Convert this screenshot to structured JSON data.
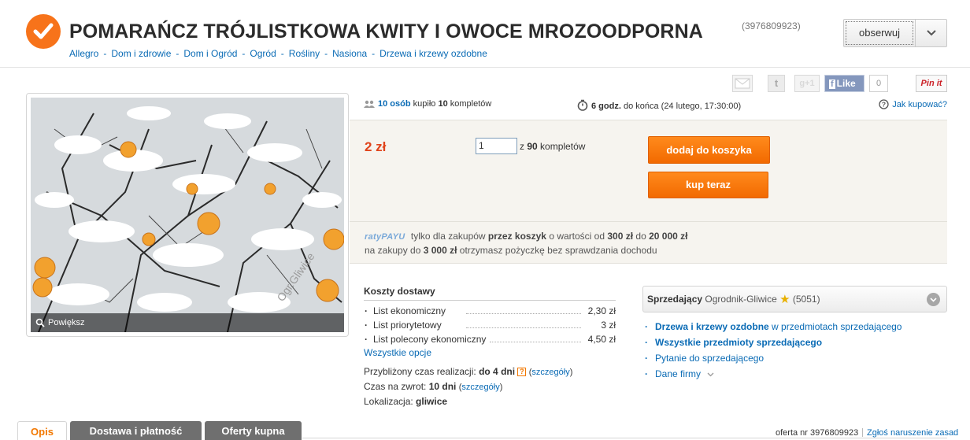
{
  "header": {
    "title": "POMARAŃCZ TRÓJLISTKOWA KWITY I OWOCE MROZOODPORNA",
    "offer_id": "(3976809923)",
    "watch_label": "obserwuj"
  },
  "breadcrumb": [
    "Allegro",
    "Dom i zdrowie",
    "Dom i Ogród",
    "Ogród",
    "Rośliny",
    "Nasiona",
    "Drzewa i krzewy ozdobne"
  ],
  "share": {
    "gplus": "g+1",
    "fb_like": "Like",
    "fb_count": "0",
    "pinit": "Pin it",
    "twitter": "t"
  },
  "image": {
    "zoom_label": "Powiększ",
    "watermark": "Ogr.Gliwice"
  },
  "stats": {
    "buyers_count": "10 osób",
    "bought_text": "kupiło",
    "kits_count": "10",
    "kits_text": "kompletów",
    "time_left": "6 godz.",
    "time_text": "do końca (24 lutego, 17:30:00)",
    "how_to_buy": "Jak kupować?"
  },
  "buy": {
    "price": "2 zł",
    "quantity": "1",
    "of_label": "z",
    "available": "90",
    "available_unit": "kompletów",
    "cart_button": "dodaj do koszyka",
    "buy_button": "kup teraz"
  },
  "raty": {
    "logo": "ratyPAYU",
    "line1_a": "tylko dla zakupów",
    "line1_b": "przez koszyk",
    "line1_c": "o wartości od",
    "min": "300 zł",
    "line1_d": "do",
    "max": "20 000 zł",
    "line2_a": "na zakupy do",
    "line2_amount": "3 000 zł",
    "line2_b": "otrzymasz pożyczkę bez sprawdzania dochodu"
  },
  "shipping": {
    "title": "Koszty dostawy",
    "options": [
      {
        "name": "List ekonomiczny",
        "price": "2,30 zł"
      },
      {
        "name": "List priorytetowy",
        "price": "3 zł"
      },
      {
        "name": "List polecony ekonomiczny",
        "price": "4,50 zł"
      }
    ],
    "all_options": "Wszystkie opcje",
    "realization_label": "Przybliżony czas realizacji:",
    "realization_value": "do 4 dni",
    "realization_help": "?",
    "details": "szczegóły",
    "return_label": "Czas na zwrot:",
    "return_value": "10 dni",
    "location_label": "Lokalizacja:",
    "location_value": "gliwice"
  },
  "seller": {
    "label": "Sprzedający",
    "name": "Ogrodnik-Gliwice",
    "rating": "(5051)",
    "links": [
      {
        "strong": "Drzewa i krzewy ozdobne",
        "rest": "w przedmiotach sprzedającego"
      },
      {
        "strong": "Wszystkie przedmioty sprzedającego",
        "rest": ""
      },
      {
        "strong": "",
        "rest": "Pytanie do sprzedającego"
      },
      {
        "strong": "",
        "rest": "Dane firmy"
      }
    ]
  },
  "tabs": [
    "Opis",
    "Dostawa i płatność",
    "Oferty kupna"
  ],
  "footer": {
    "offer_no": "oferta nr 3976809923",
    "report": "Zgłoś naruszenie zasad"
  },
  "colors": {
    "accent": "#f27800",
    "link": "#0a6bb5",
    "price": "#e0431b"
  }
}
